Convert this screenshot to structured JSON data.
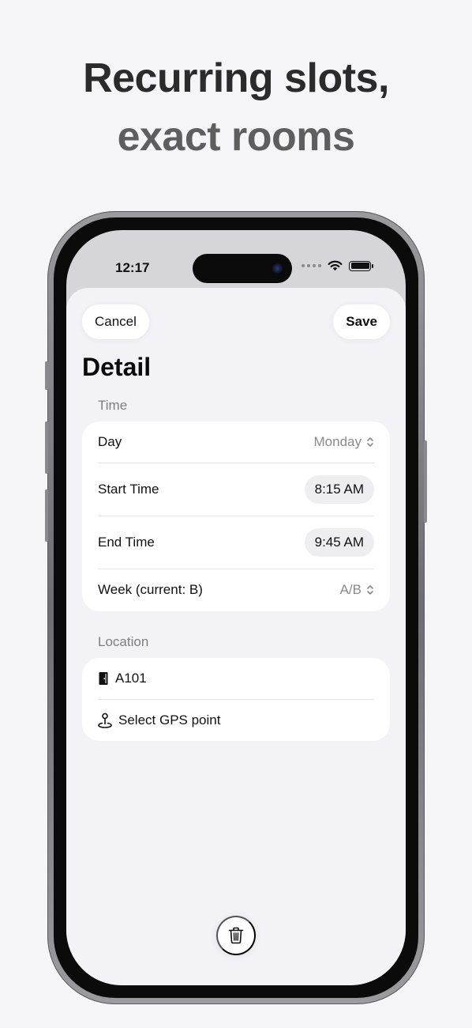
{
  "headline": {
    "line1": "Recurring slots,",
    "line2": "exact rooms"
  },
  "status_bar": {
    "time": "12:17"
  },
  "sheet": {
    "cancel_label": "Cancel",
    "save_label": "Save",
    "title": "Detail",
    "time_section": {
      "label": "Time",
      "rows": [
        {
          "label": "Day",
          "value": "Monday"
        },
        {
          "label": "Start Time",
          "value": "8:15 AM"
        },
        {
          "label": "End Time",
          "value": "9:45 AM"
        },
        {
          "label": "Week (current: B)",
          "value": "A/B"
        }
      ]
    },
    "location_section": {
      "label": "Location",
      "rows": [
        {
          "icon": "door-icon",
          "label": "A101"
        },
        {
          "icon": "map-pin-icon",
          "label": "Select GPS point"
        }
      ]
    }
  },
  "colors": {
    "background": "#f5f5f7",
    "sheet": "#f2f2f7",
    "card": "#ffffff",
    "secondary_text": "#8a8a8e"
  }
}
